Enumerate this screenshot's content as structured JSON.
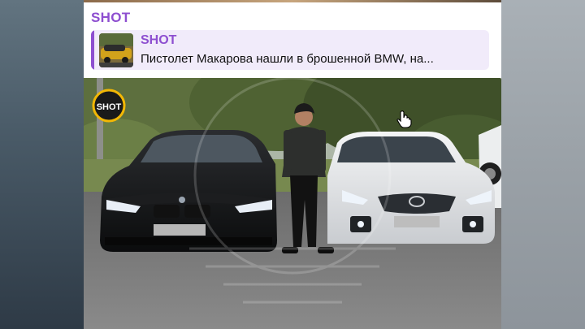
{
  "channel": {
    "name": "SHOT"
  },
  "reply": {
    "title": "SHOT",
    "text": "Пистолет Макарова нашли в брошенной BMW, на..."
  },
  "photo": {
    "watermark_text": "SHOT",
    "icons": [
      "shot-logo-icon",
      "bmw-car",
      "toyota-car",
      "person"
    ]
  },
  "colors": {
    "accent": "#8e4fd0",
    "reply_bg": "#f1ebfa",
    "logo_ring": "#f2b705"
  }
}
